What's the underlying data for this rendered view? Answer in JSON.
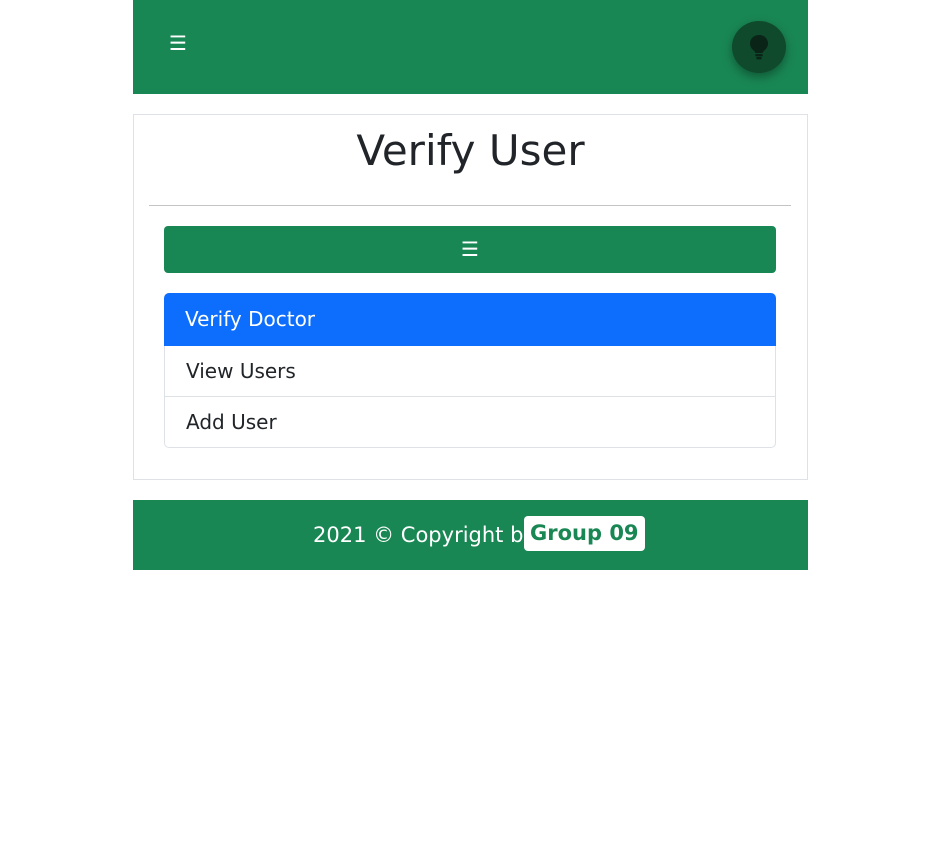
{
  "navbar": {
    "toggle_icon": "☰",
    "theme_toggle_icon": "lightbulb-icon",
    "brand_color": "#198754"
  },
  "card": {
    "title": "Verify User",
    "menu_toggle_icon": "☰",
    "menu_items": [
      {
        "label": "Verify Doctor",
        "active": true
      },
      {
        "label": "View Users",
        "active": false
      },
      {
        "label": "Add User",
        "active": false
      }
    ],
    "active_color": "#0d6efd"
  },
  "footer": {
    "text": "2021 © Copyright by",
    "link_label": "Group 09"
  }
}
